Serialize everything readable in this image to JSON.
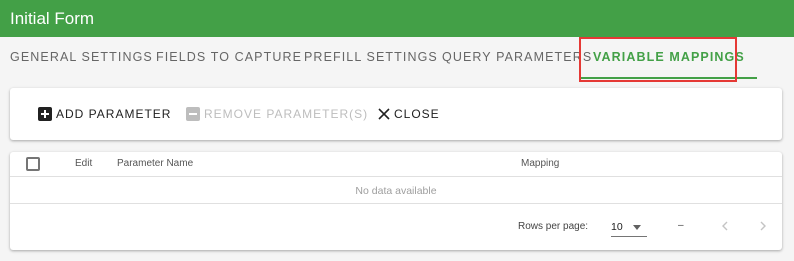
{
  "window": {
    "title": "Initial Form"
  },
  "colors": {
    "brand": "#43a047",
    "highlight": "#e53935"
  },
  "tabs": [
    {
      "label": "General Settings",
      "active": false
    },
    {
      "label": "Fields to Capture",
      "active": false
    },
    {
      "label": "Prefill Settings",
      "active": false
    },
    {
      "label": "Query Parameters",
      "active": false
    },
    {
      "label": "Variable Mappings",
      "active": true
    }
  ],
  "toolbar": {
    "add_label": "Add Parameter",
    "add_icon": "plus-box-icon",
    "remove_label": "Remove Parameter(s)",
    "remove_icon": "minus-box-icon",
    "remove_disabled": true,
    "close_label": "Close",
    "close_icon": "close-icon"
  },
  "table": {
    "columns": [
      "Edit",
      "Parameter Name",
      "Mapping"
    ],
    "empty_message": "No data available",
    "rows": []
  },
  "pagination": {
    "rows_per_page_label": "Rows per page:",
    "rows_per_page_value": "10",
    "range_text": "–",
    "prev_icon": "chevron-left-icon",
    "next_icon": "chevron-right-icon"
  }
}
